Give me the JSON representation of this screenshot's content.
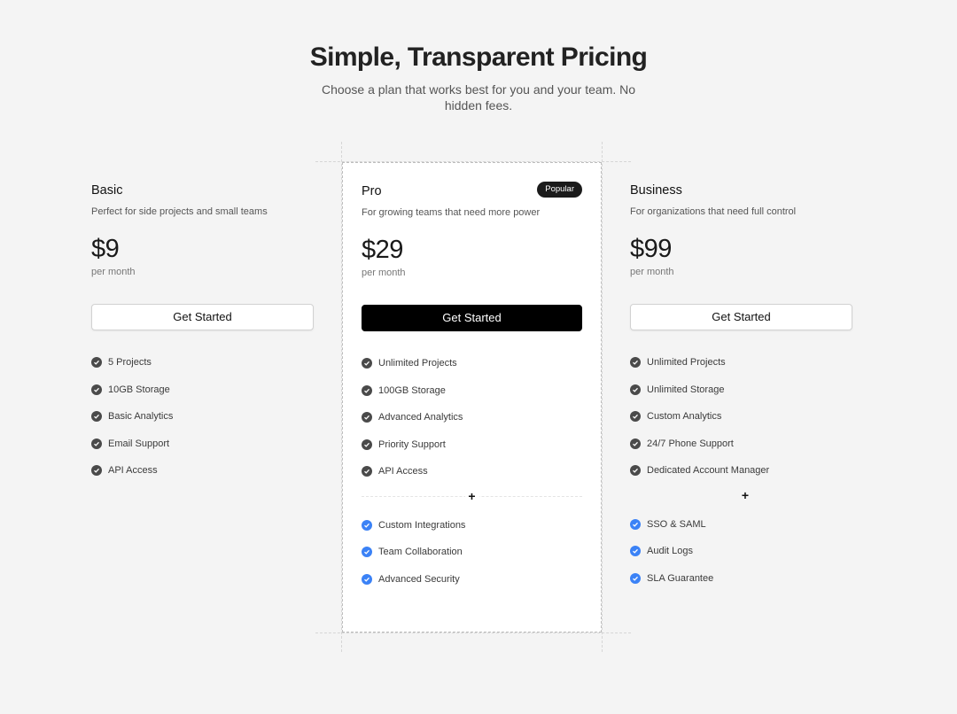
{
  "header": {
    "title": "Simple, Transparent Pricing",
    "subtitle": "Choose a plan that works best for you and your team. No hidden fees."
  },
  "colors": {
    "accent": "#3b82f6",
    "primary_button": "#000000",
    "check_dark": "#4a4a4a"
  },
  "plans": [
    {
      "name": "Basic",
      "description": "Perfect for side projects and small teams",
      "price": "$9",
      "period": "per month",
      "button": "Get Started",
      "features": [
        "5 Projects",
        "10GB Storage",
        "Basic Analytics",
        "Email Support",
        "API Access"
      ]
    },
    {
      "name": "Pro",
      "badge": "Popular",
      "description": "For growing teams that need more power",
      "price": "$29",
      "period": "per month",
      "button": "Get Started",
      "features": [
        "Unlimited Projects",
        "100GB Storage",
        "Advanced Analytics",
        "Priority Support",
        "API Access"
      ],
      "divider_icon": "+",
      "extra_features": [
        "Custom Integrations",
        "Team Collaboration",
        "Advanced Security"
      ]
    },
    {
      "name": "Business",
      "description": "For organizations that need full control",
      "price": "$99",
      "period": "per month",
      "button": "Get Started",
      "features": [
        "Unlimited Projects",
        "Unlimited Storage",
        "Custom Analytics",
        "24/7 Phone Support",
        "Dedicated Account Manager"
      ],
      "divider_icon": "+",
      "extra_features": [
        "SSO & SAML",
        "Audit Logs",
        "SLA Guarantee"
      ]
    }
  ]
}
